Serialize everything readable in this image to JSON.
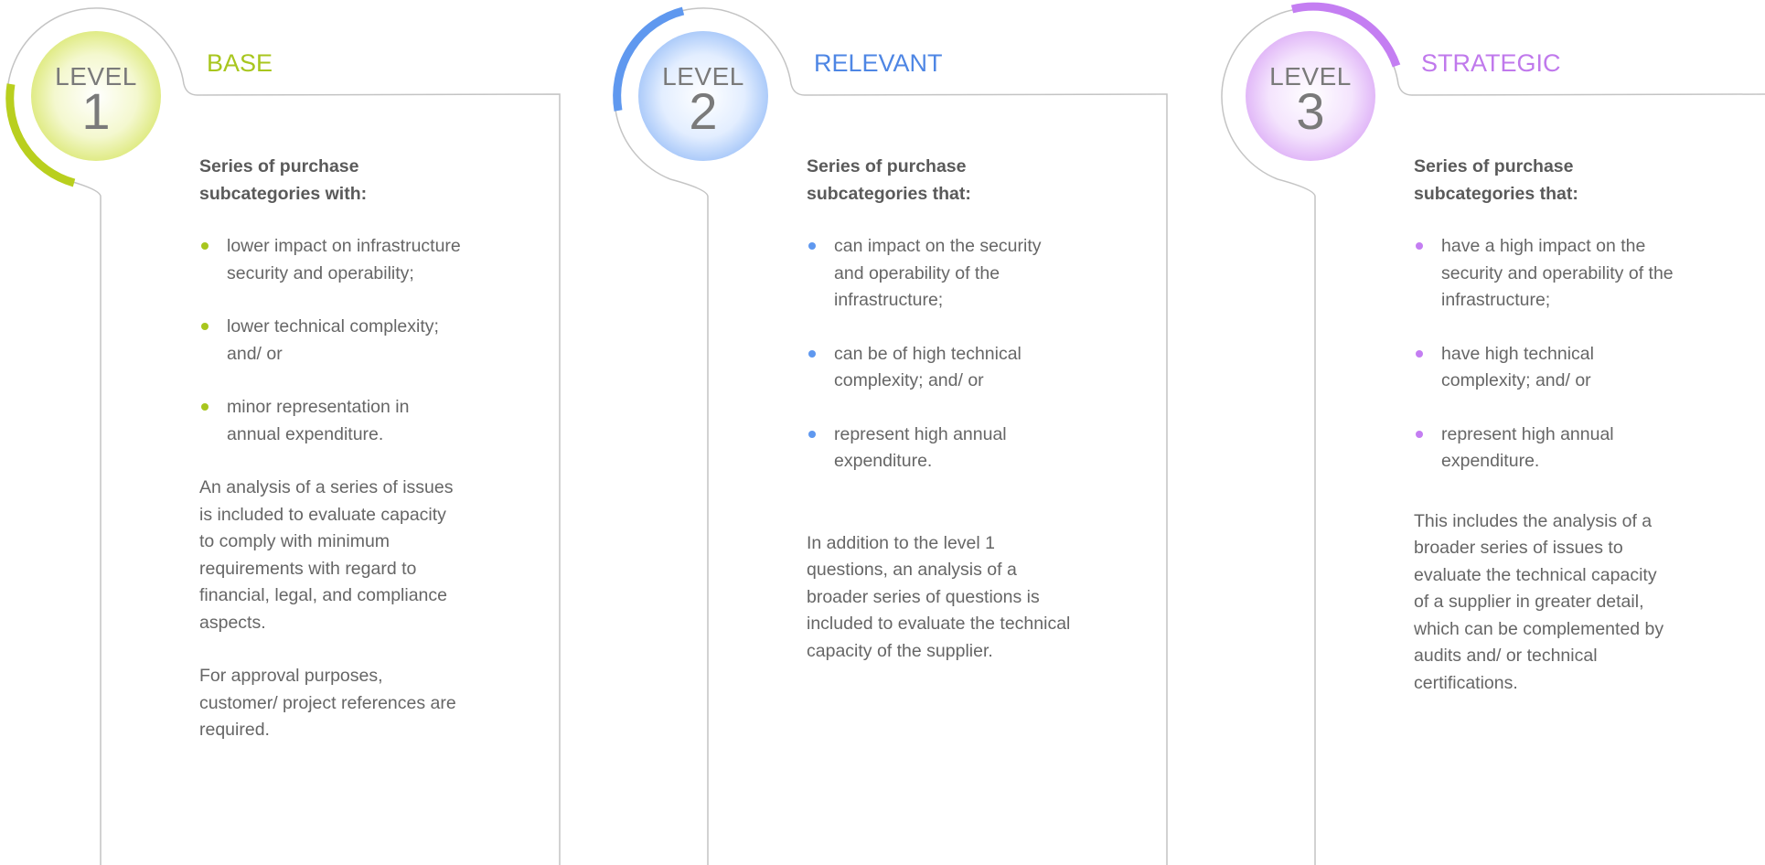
{
  "levels": [
    {
      "label": "LEVEL",
      "number": "1",
      "name": "BASE",
      "accent": "#a8c61e",
      "intro": "Series of purchase subcategories with:",
      "bullets": [
        "lower impact on infrastructure security and operability;",
        "lower technical complexity; and/ or",
        "minor representation in annual expenditure."
      ],
      "paragraphs": [
        "An analysis of a series of issues is included to evaluate capacity to comply with minimum requirements with regard to financial, legal, and compliance aspects.",
        "For approval purposes, customer/ project references are required."
      ]
    },
    {
      "label": "LEVEL",
      "number": "2",
      "name": "RELEVANT",
      "accent": "#4e86e4",
      "intro": "Series of purchase subcategories that:",
      "bullets": [
        "can impact on the security and operability of the infrastructure;",
        "can be of high technical complexity; and/ or",
        "represent high annual expenditure."
      ],
      "paragraphs": [
        "In addition to the level 1 questions, an analysis of a broader series of questions is included to evaluate the technical capacity of the supplier."
      ]
    },
    {
      "label": "LEVEL",
      "number": "3",
      "name": "STRATEGIC",
      "accent": "#c079ec",
      "intro": "Series of purchase subcategories that:",
      "bullets": [
        "have a high impact on the security and operability of the infrastructure;",
        "have high technical complexity; and/ or",
        "represent high annual expenditure."
      ],
      "paragraphs": [
        "This includes the analysis of a broader series of issues to evaluate the technical capacity of a supplier in greater detail, which can be complemented by audits and/ or technical certifications."
      ]
    }
  ]
}
